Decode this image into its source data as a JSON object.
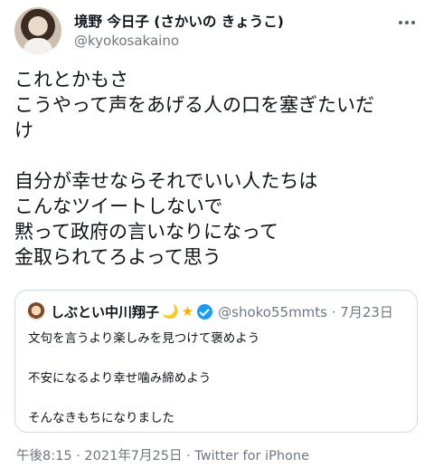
{
  "author": {
    "name": "境野 今日子 (さかいの きょうこ)",
    "handle": "@kyokosakaino"
  },
  "tweet": {
    "lines": [
      "これとかもさ",
      "こうやって声をあげる人の口を塞ぎたいだ",
      "け",
      "",
      "自分が幸せならそれでいい人たちは",
      "こんなツイートしないで",
      "黙って政府の言いなりになって",
      "金取られてろよって思う"
    ]
  },
  "quote": {
    "name": "しぶとい中川翔子",
    "emoji_moon": "🌙",
    "emoji_star": "★",
    "handle_date": "@shoko55mmts · 7月23日",
    "lines": [
      "文句を言うより楽しみを見つけて褒めよう",
      "",
      "不安になるより幸せ噛み締めよう",
      "",
      "そんなきもちになりました"
    ]
  },
  "footer": {
    "meta": "午後8:15 · 2021年7月25日 · Twitter for iPhone"
  }
}
